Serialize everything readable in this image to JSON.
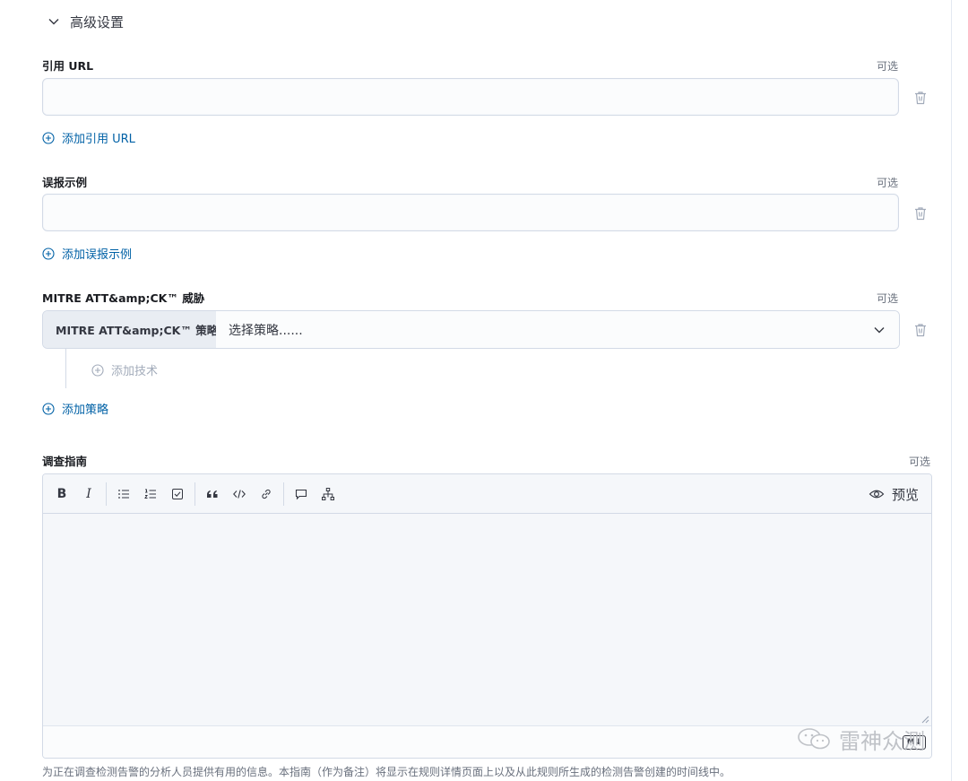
{
  "advanced": {
    "title": "高级设置"
  },
  "fields": {
    "reference_url": {
      "label": "引用 URL",
      "optional": "可选",
      "value": "",
      "add_label": "添加引用 URL"
    },
    "false_positive": {
      "label": "误报示例",
      "optional": "可选",
      "value": "",
      "add_label": "添加误报示例"
    },
    "mitre": {
      "label": "MITRE ATT&amp;CK™ 威胁",
      "optional": "可选",
      "prepend": "MITRE ATT&amp;CK™ 策略",
      "select_placeholder": "选择策略......",
      "add_technique": "添加技术",
      "add_tactic": "添加策略"
    },
    "investigation": {
      "label": "调查指南",
      "optional": "可选",
      "preview_label": "预览",
      "help": "为正在调查检测告警的分析人员提供有用的信息。本指南（作为备注）将显示在规则详情页面上以及从此规则所生成的检测告警创建的时间线中。",
      "md_badge": "M↓"
    }
  },
  "toolbar": {
    "bold": "B",
    "italic": "I",
    "icons": [
      "bold-icon",
      "italic-icon",
      "bullet-list-icon",
      "numbered-list-icon",
      "task-list-icon",
      "quote-icon",
      "code-icon",
      "link-icon",
      "comment-icon",
      "tree-icon",
      "eye-icon"
    ]
  },
  "watermark": {
    "text": "雷神众测"
  },
  "colors": {
    "link": "#0061a6",
    "border": "#d3dae6",
    "muted": "#69707d"
  }
}
